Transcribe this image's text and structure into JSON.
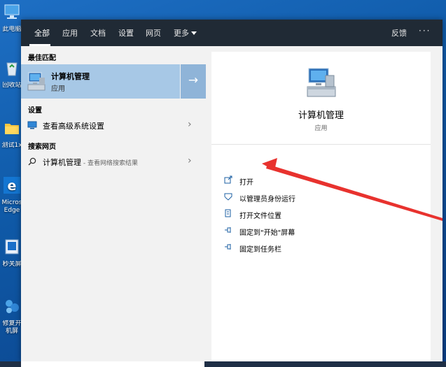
{
  "desktop": {
    "icons": [
      {
        "label": "此电脑",
        "icon": "computer-icon"
      },
      {
        "label": "回收站",
        "icon": "recycle-bin-icon"
      },
      {
        "label": "测试1x",
        "icon": "folder-icon"
      },
      {
        "label": "Micros Edge",
        "icon": "edge-icon"
      },
      {
        "label": "秒关屏",
        "icon": "app-icon"
      },
      {
        "label": "修复开机屏",
        "icon": "repair-tool-icon"
      }
    ]
  },
  "topbar": {
    "tabs": [
      {
        "label": "全部",
        "active": true
      },
      {
        "label": "应用",
        "active": false
      },
      {
        "label": "文档",
        "active": false
      },
      {
        "label": "设置",
        "active": false
      },
      {
        "label": "网页",
        "active": false
      },
      {
        "label": "更多",
        "active": false
      }
    ],
    "feedback": "反馈",
    "more_options": "···"
  },
  "results": {
    "best_match_header": "最佳匹配",
    "best_match": {
      "title": "计算机管理",
      "subtitle": "应用",
      "icon": "computer-management-icon"
    },
    "settings_header": "设置",
    "settings_item": {
      "label": "查看高级系统设置",
      "icon": "system-settings-icon"
    },
    "web_header": "搜索网页",
    "web_item": {
      "label": "计算机管理",
      "suffix": " - 查看网络搜索结果",
      "icon": "search-icon"
    }
  },
  "detail": {
    "title": "计算机管理",
    "subtitle": "应用",
    "actions": [
      {
        "label": "打开",
        "icon": "open-icon"
      },
      {
        "label": "以管理员身份运行",
        "icon": "shield-icon"
      },
      {
        "label": "打开文件位置",
        "icon": "file-location-icon"
      },
      {
        "label": "固定到\"开始\"屏幕",
        "icon": "pin-icon"
      },
      {
        "label": "固定到任务栏",
        "icon": "pin-icon"
      }
    ]
  },
  "colors": {
    "topbar_bg": "#202a35",
    "panel_bg": "#f2f2f2",
    "best_match_highlight": "#a7c8e6",
    "annotation_arrow": "#e8322e"
  }
}
